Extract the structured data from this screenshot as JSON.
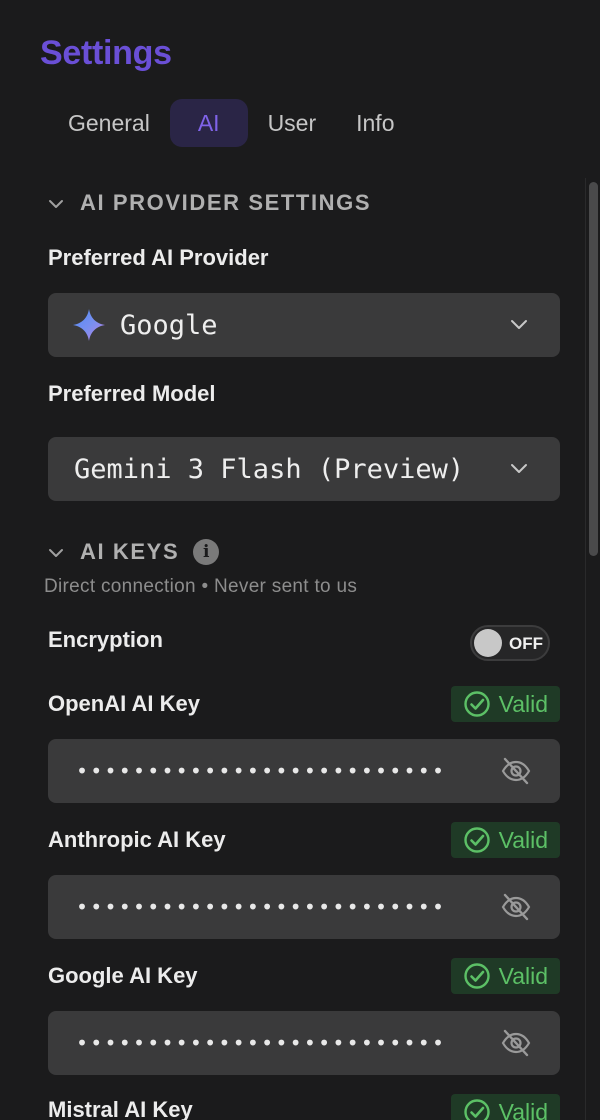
{
  "header": {
    "title": "Settings"
  },
  "tabs": [
    {
      "label": "General",
      "active": false
    },
    {
      "label": "AI",
      "active": true
    },
    {
      "label": "User",
      "active": false
    },
    {
      "label": "Info",
      "active": false
    }
  ],
  "provider_section": {
    "title": "AI PROVIDER SETTINGS",
    "provider_label": "Preferred AI Provider",
    "provider_value": "Google",
    "model_label": "Preferred Model",
    "model_value": "Gemini 3 Flash (Preview)"
  },
  "keys_section": {
    "title": "AI KEYS",
    "subtitle": "Direct connection • Never sent to us",
    "encryption_label": "Encryption",
    "encryption_state": "OFF",
    "keys": [
      {
        "label": "OpenAI AI Key",
        "status": "Valid",
        "masked": "••••••••••••••••••••••••••"
      },
      {
        "label": "Anthropic AI Key",
        "status": "Valid",
        "masked": "••••••••••••••••••••••••••"
      },
      {
        "label": "Google AI Key",
        "status": "Valid",
        "masked": "••••••••••••••••••••••••••"
      },
      {
        "label": "Mistral AI Key",
        "status": "Valid",
        "masked": ""
      }
    ]
  },
  "colors": {
    "accent": "#6a4fd6",
    "valid_text": "#5cc066",
    "valid_bg": "#1f3a26",
    "panel_bg": "#1b1b1c",
    "field_bg": "#3a3a3b"
  },
  "icons": {
    "provider": "google-gemini-sparkle-icon",
    "collapse": "chevron-down-icon",
    "info": "info-icon",
    "valid": "check-circle-icon",
    "reveal": "eye-off-icon"
  }
}
